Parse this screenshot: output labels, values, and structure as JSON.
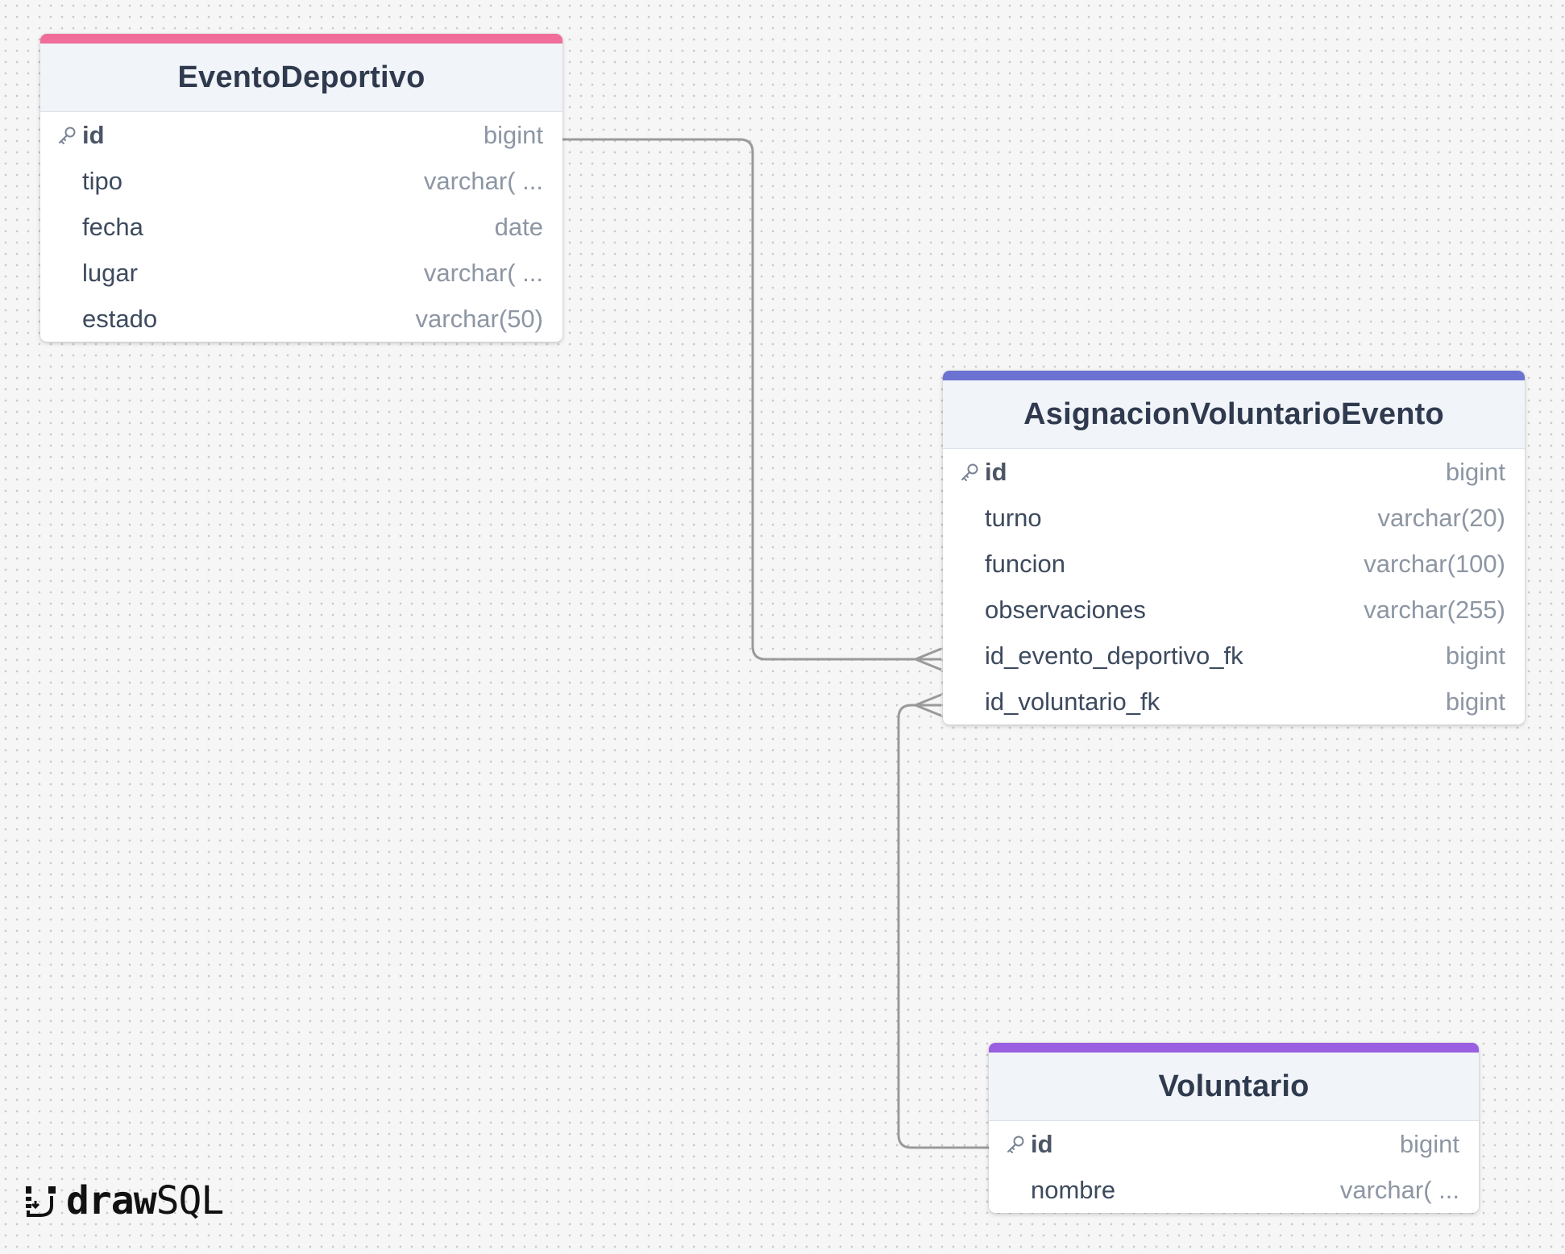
{
  "tables": [
    {
      "name": "EventoDeportivo",
      "accent_color": "#f06d99",
      "columns": [
        {
          "name": "id",
          "type": "bigint",
          "pk": true
        },
        {
          "name": "tipo",
          "type": "varchar( ...",
          "pk": false
        },
        {
          "name": "fecha",
          "type": "date",
          "pk": false
        },
        {
          "name": "lugar",
          "type": "varchar( ...",
          "pk": false
        },
        {
          "name": "estado",
          "type": "varchar(50)",
          "pk": false
        }
      ]
    },
    {
      "name": "AsignacionVoluntarioEvento",
      "accent_color": "#6b72d1",
      "columns": [
        {
          "name": "id",
          "type": "bigint",
          "pk": true
        },
        {
          "name": "turno",
          "type": "varchar(20)",
          "pk": false
        },
        {
          "name": "funcion",
          "type": "varchar(100)",
          "pk": false
        },
        {
          "name": "observaciones",
          "type": "varchar(255)",
          "pk": false
        },
        {
          "name": "id_evento_deportivo_fk",
          "type": "bigint",
          "pk": false
        },
        {
          "name": "id_voluntario_fk",
          "type": "bigint",
          "pk": false
        }
      ]
    },
    {
      "name": "Voluntario",
      "accent_color": "#9a5fe0",
      "columns": [
        {
          "name": "id",
          "type": "bigint",
          "pk": true
        },
        {
          "name": "nombre",
          "type": "varchar( ...",
          "pk": false
        }
      ]
    }
  ],
  "relations": [
    {
      "from": "EventoDeportivo.id",
      "to": "AsignacionVoluntarioEvento.id_evento_deportivo_fk",
      "cardinality": "one-to-many"
    },
    {
      "from": "Voluntario.id",
      "to": "AsignacionVoluntarioEvento.id_voluntario_fk",
      "cardinality": "one-to-many"
    }
  ],
  "colors": {
    "connector": "#9a9a9a",
    "key_icon": "#7a8494"
  },
  "logo": {
    "bold": "draw",
    "light": "SQL",
    "icon": "drawsql-logo-icon"
  }
}
